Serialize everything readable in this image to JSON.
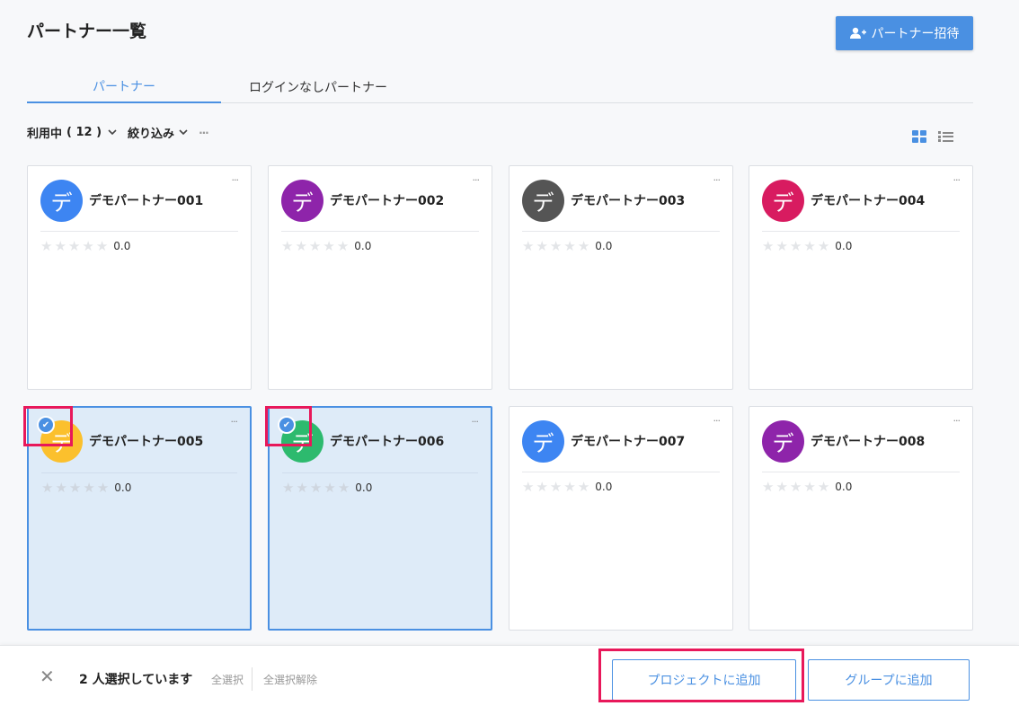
{
  "header": {
    "title": "パートナー一覧",
    "invite_label": "パートナー招待"
  },
  "tabs": [
    {
      "label": "パートナー",
      "active": true
    },
    {
      "label": "ログインなしパートナー",
      "active": false
    }
  ],
  "filter": {
    "status_label": "利用中",
    "status_count": "( 12 )",
    "narrow_label": "絞り込み",
    "more": "···"
  },
  "colors": {
    "accent": "#4a90e2",
    "highlight": "#e8185a",
    "selected_bg": "#deebf8"
  },
  "partners": [
    {
      "avatar_char": "デ",
      "name": "デモパートナー001",
      "score": "0.0",
      "rating": 0,
      "avatar_color": "#3d85f2",
      "selected": false
    },
    {
      "avatar_char": "デ",
      "name": "デモパートナー002",
      "score": "0.0",
      "rating": 0,
      "avatar_color": "#8e24aa",
      "selected": false
    },
    {
      "avatar_char": "デ",
      "name": "デモパートナー003",
      "score": "0.0",
      "rating": 0,
      "avatar_color": "#555555",
      "selected": false
    },
    {
      "avatar_char": "デ",
      "name": "デモパートナー004",
      "score": "0.0",
      "rating": 0,
      "avatar_color": "#d81b60",
      "selected": false
    },
    {
      "avatar_char": "デ",
      "name": "デモパートナー005",
      "score": "0.0",
      "rating": 0,
      "avatar_color": "#fbc02d",
      "selected": true
    },
    {
      "avatar_char": "デ",
      "name": "デモパートナー006",
      "score": "0.0",
      "rating": 0,
      "avatar_color": "#2dba6e",
      "selected": true
    },
    {
      "avatar_char": "デ",
      "name": "デモパートナー007",
      "score": "0.0",
      "rating": 0,
      "avatar_color": "#3d85f2",
      "selected": false
    },
    {
      "avatar_char": "デ",
      "name": "デモパートナー008",
      "score": "0.0",
      "rating": 0,
      "avatar_color": "#8e24aa",
      "selected": false
    }
  ],
  "selection": {
    "count_label": "2 人選択しています",
    "select_all": "全選択",
    "deselect_all": "全選択解除",
    "add_to_project": "プロジェクトに追加",
    "add_to_group": "グループに追加"
  }
}
